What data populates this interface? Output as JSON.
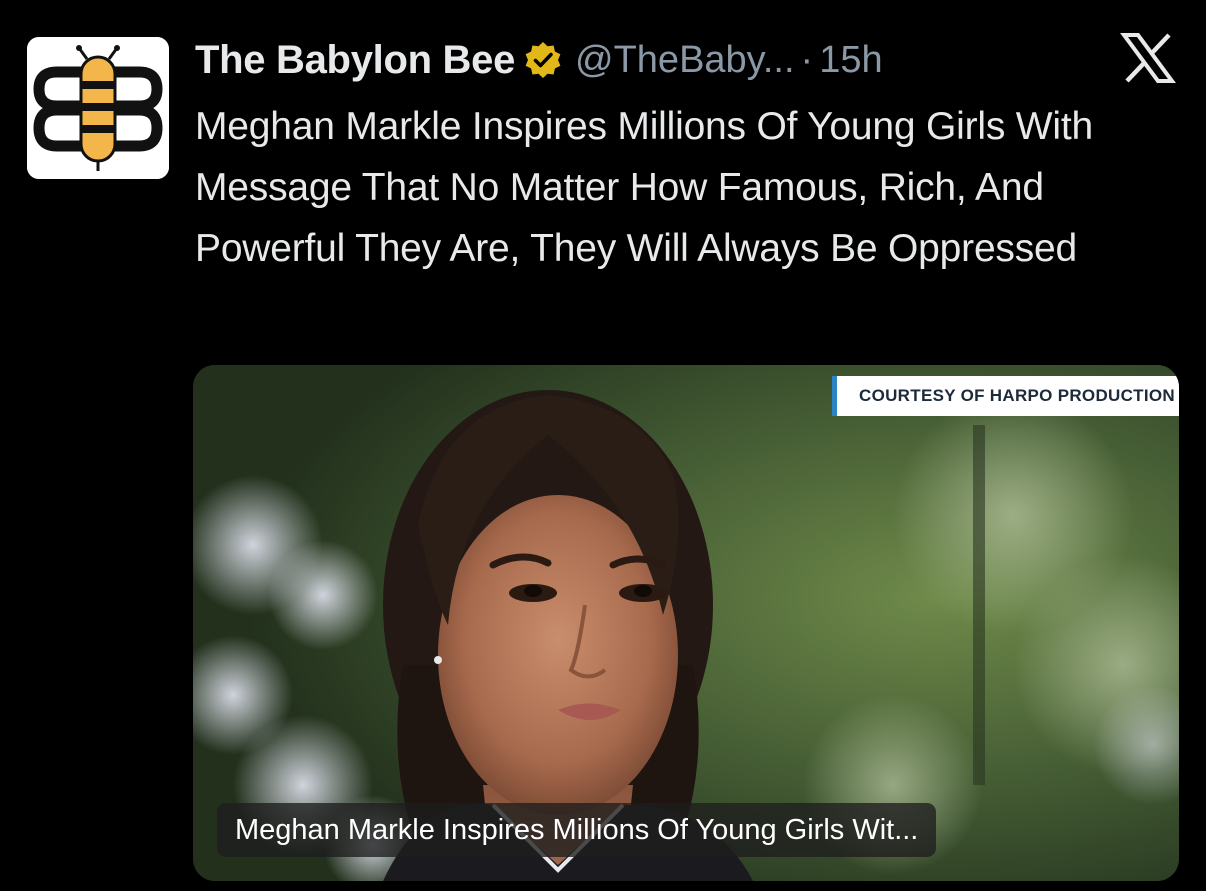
{
  "post": {
    "display_name": "The Babylon Bee",
    "handle": "@TheBaby...",
    "separator": "·",
    "timestamp": "15h",
    "text": "Meghan Markle Inspires Millions Of Young Girls With Message That No Matter How Famous, Rich, And Powerful They Are, They Will Always Be Oppressed",
    "media": {
      "credit_overlay": "COURTESY OF HARPO PRODUCTION",
      "caption": "Meghan Markle Inspires Millions Of Young Girls Wit..."
    }
  },
  "icons": {
    "avatar": "babylon-bee-logo",
    "verified": "verified-badge-icon",
    "platform": "x-logo-icon"
  },
  "colors": {
    "background": "#000000",
    "primary_text": "#e7e9ea",
    "secondary_text": "#8b98a5",
    "verified_gold": "#e2b719",
    "bee_yellow": "#f2b64a",
    "credit_accent": "#2a84c6"
  }
}
